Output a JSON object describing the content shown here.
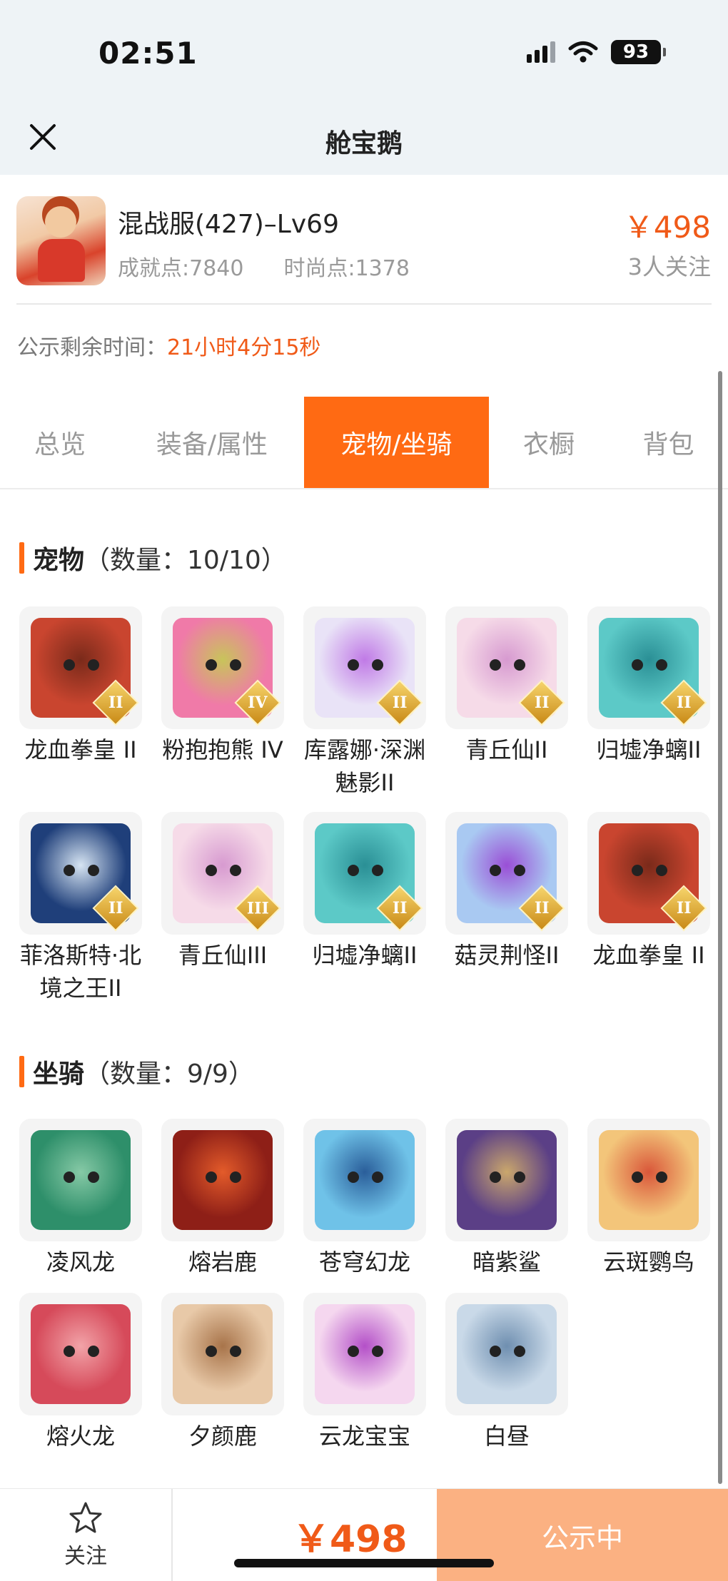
{
  "status": {
    "time": "02:51",
    "battery": "93"
  },
  "nav": {
    "title": "舱宝鹅"
  },
  "product": {
    "name": "混战服(427)–Lv69",
    "achievement": "成就点:7840",
    "fashion": "时尚点:1378",
    "price": "￥498",
    "followers": "3人关注"
  },
  "notice": {
    "label": "公示剩余时间：",
    "remaining": "21小时4分15秒"
  },
  "tabs": [
    {
      "label": "总览",
      "active": false
    },
    {
      "label": "装备/属性",
      "active": false
    },
    {
      "label": "宠物/坐骑",
      "active": true
    },
    {
      "label": "衣橱",
      "active": false
    },
    {
      "label": "背包",
      "active": false
    }
  ],
  "pets": {
    "title": "宠物",
    "count": "（数量：10/10）",
    "items": [
      {
        "name": "龙血拳皇 II",
        "badge": "II",
        "color": "#c9452f",
        "accent": "#7a2a1a"
      },
      {
        "name": "粉抱抱熊 IV",
        "badge": "IV",
        "color": "#f07aa8",
        "accent": "#c8c45a"
      },
      {
        "name": "库露娜·深渊魅影II",
        "badge": "II",
        "color": "#e9e3f7",
        "accent": "#c07ae6"
      },
      {
        "name": "青丘仙II",
        "badge": "II",
        "color": "#f6dbe8",
        "accent": "#d79ad0"
      },
      {
        "name": "归墟净螭II",
        "badge": "II",
        "color": "#5cc9c7",
        "accent": "#2a8f95"
      },
      {
        "name": "菲洛斯特·北境之王II",
        "badge": "II",
        "color": "#1f3f7a",
        "accent": "#d6e4f2"
      },
      {
        "name": "青丘仙III",
        "badge": "III",
        "color": "#f6dbe8",
        "accent": "#d79ad0"
      },
      {
        "name": "归墟净螭II",
        "badge": "II",
        "color": "#5cc9c7",
        "accent": "#2a8f95"
      },
      {
        "name": "菇灵荆怪II",
        "badge": "II",
        "color": "#a9c9f2",
        "accent": "#9a4fd6"
      },
      {
        "name": "龙血拳皇 II",
        "badge": "II",
        "color": "#c9452f",
        "accent": "#7a2a1a"
      }
    ]
  },
  "mounts": {
    "title": "坐骑",
    "count": "（数量：9/9）",
    "items": [
      {
        "name": "凌风龙",
        "color": "#2e8f6a",
        "accent": "#86c9a6"
      },
      {
        "name": "熔岩鹿",
        "color": "#8e1f17",
        "accent": "#e35b2a"
      },
      {
        "name": "苍穹幻龙",
        "color": "#6fc2e8",
        "accent": "#2a5e9a"
      },
      {
        "name": "暗紫鲨",
        "color": "#5b3f86",
        "accent": "#caa76c"
      },
      {
        "name": "云斑鹦鸟",
        "color": "#f3c57a",
        "accent": "#d9573a"
      },
      {
        "name": "熔火龙",
        "color": "#d64a5a",
        "accent": "#f2a3a8"
      },
      {
        "name": "夕颜鹿",
        "color": "#e8c9a8",
        "accent": "#a8744a"
      },
      {
        "name": "云龙宝宝",
        "color": "#f5d7ef",
        "accent": "#b450c8"
      },
      {
        "name": "白昼",
        "color": "#c9d9e8",
        "accent": "#6f8fb0"
      }
    ]
  },
  "bottom": {
    "follow_label": "关注",
    "price": "￥498",
    "status_button": "公示中"
  },
  "colors": {
    "accent": "#ff6a13",
    "price": "#f05a18",
    "status_button_bg": "#fbb182",
    "topbar_bg": "#eef3f6"
  }
}
